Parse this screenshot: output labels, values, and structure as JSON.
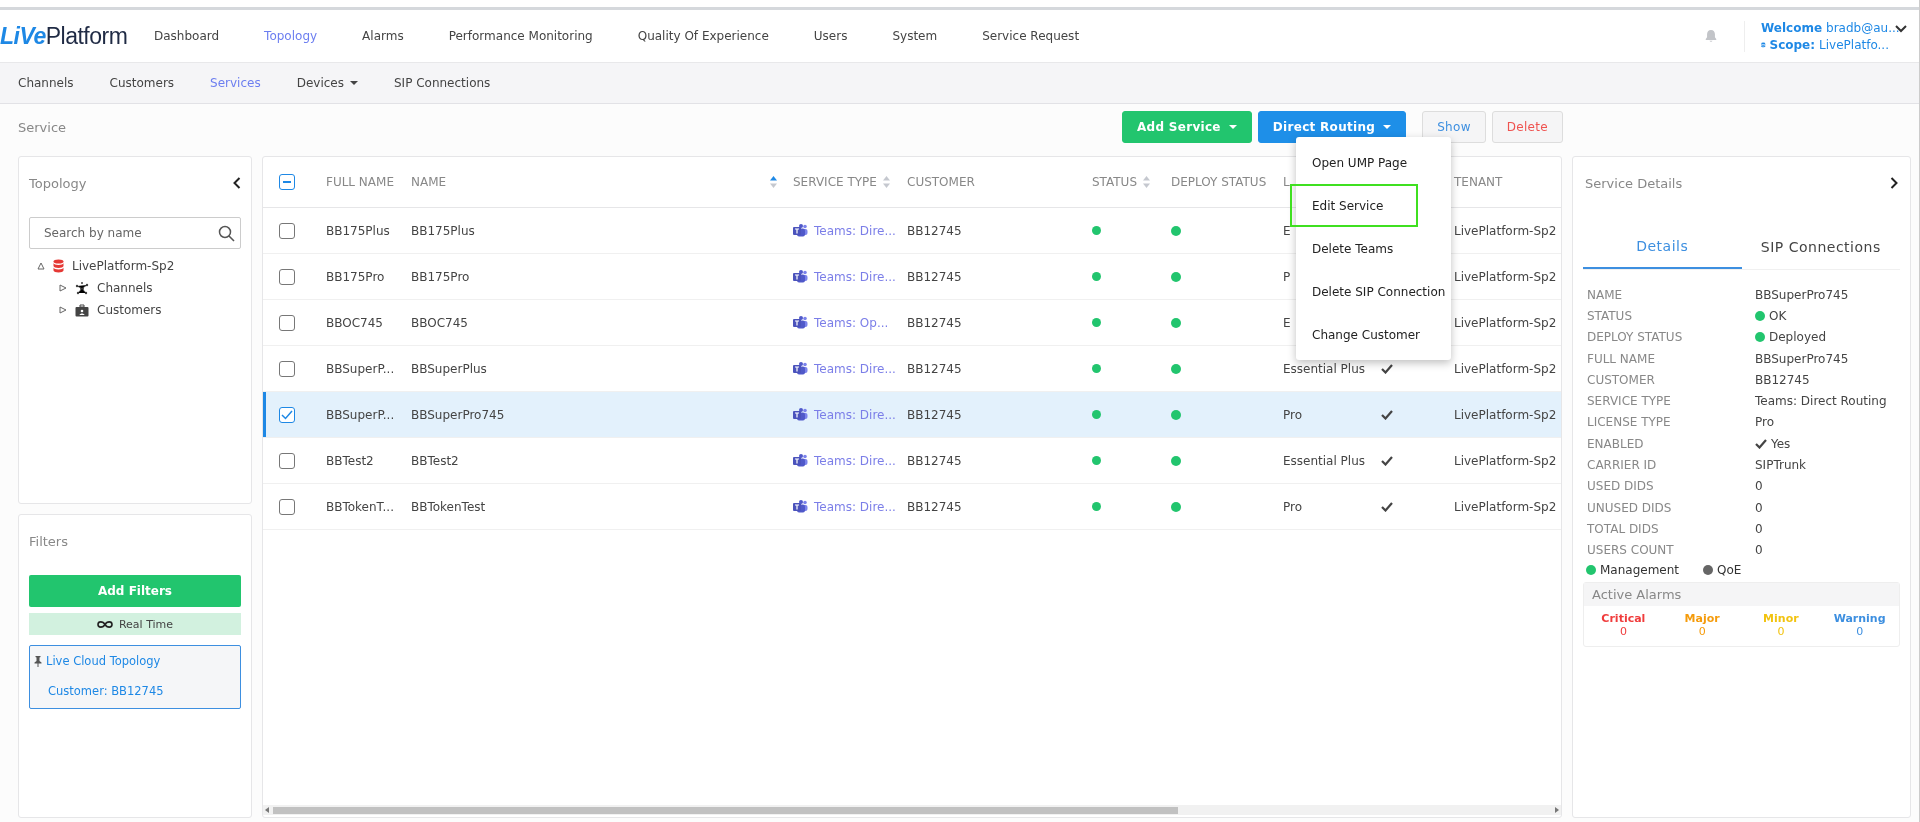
{
  "logo": {
    "part1": "LiVe",
    "part2": "Platform"
  },
  "nav": [
    {
      "label": "Dashboard",
      "selected": false
    },
    {
      "label": "Topology",
      "selected": true
    },
    {
      "label": "Alarms",
      "selected": false
    },
    {
      "label": "Performance Monitoring",
      "selected": false
    },
    {
      "label": "Quality Of Experience",
      "selected": false
    },
    {
      "label": "Users",
      "selected": false
    },
    {
      "label": "System",
      "selected": false
    },
    {
      "label": "Service Request",
      "selected": false
    }
  ],
  "user": {
    "welcome_label": "Welcome",
    "welcome_value": "bradb@au...",
    "scope_label": "Scope:",
    "scope_value": "LivePlatfo..."
  },
  "subnav": [
    {
      "label": "Channels",
      "selected": false,
      "dropdown": false
    },
    {
      "label": "Customers",
      "selected": false,
      "dropdown": false
    },
    {
      "label": "Services",
      "selected": true,
      "dropdown": false
    },
    {
      "label": "Devices",
      "selected": false,
      "dropdown": true
    },
    {
      "label": "SIP Connections",
      "selected": false,
      "dropdown": false
    }
  ],
  "page_title": "Service",
  "actions": [
    {
      "label": "Add Service",
      "kind": "success",
      "dropdown": true
    },
    {
      "label": "Direct Routing",
      "kind": "primary",
      "dropdown": true
    },
    {
      "label": "Show",
      "kind": "info",
      "dropdown": false
    },
    {
      "label": "Delete",
      "kind": "danger",
      "dropdown": false
    }
  ],
  "menu": [
    {
      "label": "Open UMP Page",
      "highlighted": false
    },
    {
      "label": "Edit Service",
      "highlighted": true
    },
    {
      "label": "Delete Teams",
      "highlighted": false
    },
    {
      "label": "Delete SIP Connection",
      "highlighted": false
    },
    {
      "label": "Change Customer",
      "highlighted": false
    }
  ],
  "topology": {
    "title": "Topology",
    "search": {
      "placeholder": "Search by name"
    },
    "tree": [
      {
        "label": "LivePlatform-Sp2",
        "expanded": true,
        "children": [
          {
            "label": "Channels",
            "expanded": false
          },
          {
            "label": "Customers",
            "expanded": false
          }
        ]
      }
    ]
  },
  "filters": {
    "title": "Filters",
    "add_button": "Add Filters",
    "realtime": "Real Time",
    "pinned_title": "Live Cloud Topology",
    "pinned_value": "Customer: BB12745"
  },
  "table": {
    "header_partial": true,
    "columns": [
      {
        "label": "FULL NAME",
        "sortable": false
      },
      {
        "label": "NAME",
        "sortable": true
      },
      {
        "label": "SERVICE TYPE",
        "sortable": true
      },
      {
        "label": "CUSTOMER",
        "sortable": false
      },
      {
        "label": "STATUS",
        "sortable": true
      },
      {
        "label": "DEPLOY STATUS",
        "sortable": false
      },
      {
        "label": "L"
      },
      {
        "label": "TENANT",
        "sortable": false
      }
    ],
    "rows": [
      {
        "full_name": "BB175Plus",
        "name": "BB175Plus",
        "service_type": "Teams: Dire...",
        "customer": "BB12745",
        "status_ok": true,
        "deployed": true,
        "license": "E",
        "tenant": "LivePlatform-Sp2",
        "selected": false
      },
      {
        "full_name": "BB175Pro",
        "name": "BB175Pro",
        "service_type": "Teams: Dire...",
        "customer": "BB12745",
        "status_ok": true,
        "deployed": true,
        "license": "P",
        "tenant": "LivePlatform-Sp2",
        "selected": false
      },
      {
        "full_name": "BBOC745",
        "name": "BBOC745",
        "service_type": "Teams: Op...",
        "customer": "BB12745",
        "status_ok": true,
        "deployed": true,
        "license": "E",
        "tenant": "LivePlatform-Sp2",
        "selected": false
      },
      {
        "full_name": "BBSuperP...",
        "name": "BBSuperPlus",
        "service_type": "Teams: Dire...",
        "customer": "BB12745",
        "status_ok": true,
        "deployed": true,
        "license": "Essential Plus",
        "enabled": true,
        "tenant": "LivePlatform-Sp2",
        "selected": false
      },
      {
        "full_name": "BBSuperP...",
        "name": "BBSuperPro745",
        "service_type": "Teams: Dire...",
        "customer": "BB12745",
        "status_ok": true,
        "deployed": true,
        "license": "Pro",
        "enabled": true,
        "tenant": "LivePlatform-Sp2",
        "selected": true
      },
      {
        "full_name": "BBTest2",
        "name": "BBTest2",
        "service_type": "Teams: Dire...",
        "customer": "BB12745",
        "status_ok": true,
        "deployed": true,
        "license": "Essential Plus",
        "enabled": true,
        "tenant": "LivePlatform-Sp2",
        "selected": false
      },
      {
        "full_name": "BBTokenT...",
        "name": "BBTokenTest",
        "service_type": "Teams: Dire...",
        "customer": "BB12745",
        "status_ok": true,
        "deployed": true,
        "license": "Pro",
        "enabled": true,
        "tenant": "LivePlatform-Sp2",
        "selected": false
      }
    ]
  },
  "details": {
    "title": "Service Details",
    "tabs": [
      {
        "label": "Details",
        "selected": true
      },
      {
        "label": "SIP Connections",
        "selected": false
      }
    ],
    "fields": [
      {
        "label": "NAME",
        "value": "BBSuperPro745",
        "kind": "text"
      },
      {
        "label": "STATUS",
        "value": "OK",
        "kind": "dot",
        "color": "#22c56e"
      },
      {
        "label": "DEPLOY STATUS",
        "value": "Deployed",
        "kind": "dot",
        "color": "#22c56e"
      },
      {
        "label": "FULL NAME",
        "value": "BBSuperPro745",
        "kind": "text"
      },
      {
        "label": "CUSTOMER",
        "value": "BB12745",
        "kind": "text"
      },
      {
        "label": "SERVICE TYPE",
        "value": "Teams: Direct Routing",
        "kind": "text"
      },
      {
        "label": "LICENSE TYPE",
        "value": "Pro",
        "kind": "text"
      },
      {
        "label": "ENABLED",
        "value": "Yes",
        "kind": "check"
      },
      {
        "label": "CARRIER ID",
        "value": "SIPTrunk",
        "kind": "text"
      },
      {
        "label": "USED DIDS",
        "value": "0",
        "kind": "text"
      },
      {
        "label": "UNUSED DIDS",
        "value": "0",
        "kind": "text"
      },
      {
        "label": "TOTAL DIDS",
        "value": "0",
        "kind": "text"
      },
      {
        "label": "USERS COUNT",
        "value": "0",
        "kind": "text"
      }
    ],
    "legend": [
      {
        "label": "Management",
        "color": "#22c56e"
      },
      {
        "label": "QoE",
        "color": "#666666"
      }
    ],
    "alarms_title": "Active Alarms",
    "alarms": [
      {
        "label": "Critical",
        "count": "0",
        "color": "#f03c3c"
      },
      {
        "label": "Major",
        "count": "0",
        "color": "#f59b0b"
      },
      {
        "label": "Minor",
        "count": "0",
        "color": "#f2c30f"
      },
      {
        "label": "Warning",
        "count": "0",
        "color": "#3d8fe0"
      }
    ]
  }
}
